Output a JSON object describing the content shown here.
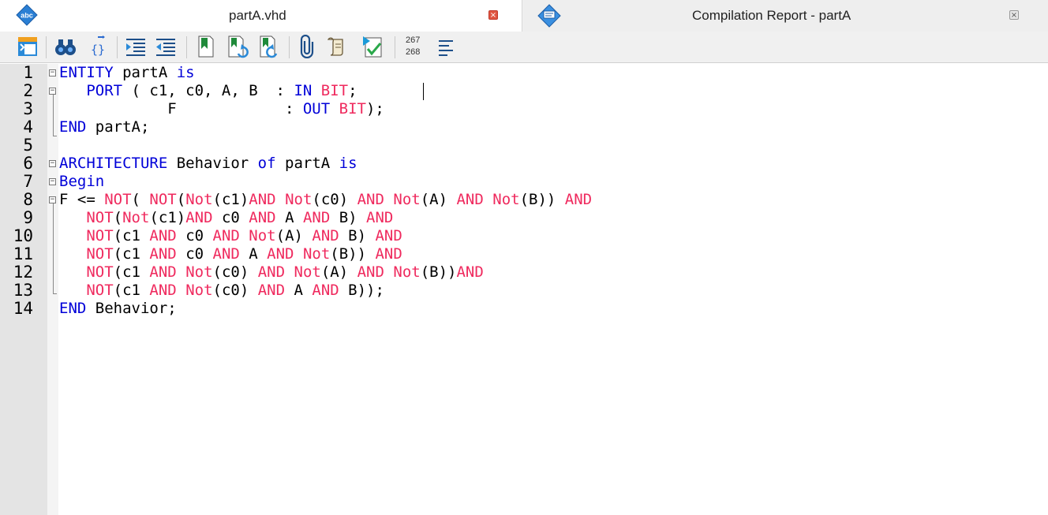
{
  "tabs": [
    {
      "label": "partA.vhd",
      "active": true,
      "icon": "abc-vhdl-file-icon",
      "close_label": "×"
    },
    {
      "label": "Compilation Report - partA",
      "active": false,
      "icon": "compilation-report-icon",
      "close_label": "×"
    }
  ],
  "toolbar": {
    "buttons": [
      "insert-template-icon",
      "find-binoculars-icon",
      "find-matching-brace-icon",
      "increase-indent-icon",
      "decrease-indent-icon",
      "toggle-bookmark-icon",
      "next-bookmark-icon",
      "previous-bookmark-icon",
      "attach-paperclip-icon",
      "insert-scroll-icon",
      "start-compilation-check-icon",
      "go-to-line-icon",
      "toggle-word-wrap-icon"
    ],
    "line_counter": {
      "top": "267",
      "bottom": "268"
    }
  },
  "editor": {
    "line_numbers": [
      "1",
      "2",
      "3",
      "4",
      "5",
      "6",
      "7",
      "8",
      "9",
      "10",
      "11",
      "12",
      "13",
      "14"
    ],
    "lines": [
      [
        {
          "t": "ENTITY",
          "c": "kw"
        },
        {
          "t": " partA ",
          "c": "txt"
        },
        {
          "t": "is",
          "c": "kw"
        }
      ],
      [
        {
          "t": "   ",
          "c": "txt"
        },
        {
          "t": "PORT",
          "c": "kw"
        },
        {
          "t": " ( c1, c0, A, B  : ",
          "c": "txt"
        },
        {
          "t": "IN",
          "c": "kw"
        },
        {
          "t": " ",
          "c": "txt"
        },
        {
          "t": "BIT",
          "c": "op"
        },
        {
          "t": ";",
          "c": "txt"
        }
      ],
      [
        {
          "t": "            F            : ",
          "c": "txt"
        },
        {
          "t": "OUT",
          "c": "kw"
        },
        {
          "t": " ",
          "c": "txt"
        },
        {
          "t": "BIT",
          "c": "op"
        },
        {
          "t": ");",
          "c": "txt"
        }
      ],
      [
        {
          "t": "END",
          "c": "kw"
        },
        {
          "t": " partA;",
          "c": "txt"
        }
      ],
      [],
      [
        {
          "t": "ARCHITECTURE",
          "c": "kw"
        },
        {
          "t": " Behavior ",
          "c": "txt"
        },
        {
          "t": "of",
          "c": "kw"
        },
        {
          "t": " partA ",
          "c": "txt"
        },
        {
          "t": "is",
          "c": "kw"
        }
      ],
      [
        {
          "t": "Begin",
          "c": "kw"
        }
      ],
      [
        {
          "t": "F <= ",
          "c": "txt"
        },
        {
          "t": "NOT",
          "c": "op"
        },
        {
          "t": "( ",
          "c": "txt"
        },
        {
          "t": "NOT",
          "c": "op"
        },
        {
          "t": "(",
          "c": "txt"
        },
        {
          "t": "Not",
          "c": "op"
        },
        {
          "t": "(c1)",
          "c": "txt"
        },
        {
          "t": "AND",
          "c": "op"
        },
        {
          "t": " ",
          "c": "txt"
        },
        {
          "t": "Not",
          "c": "op"
        },
        {
          "t": "(c0) ",
          "c": "txt"
        },
        {
          "t": "AND",
          "c": "op"
        },
        {
          "t": " ",
          "c": "txt"
        },
        {
          "t": "Not",
          "c": "op"
        },
        {
          "t": "(A) ",
          "c": "txt"
        },
        {
          "t": "AND",
          "c": "op"
        },
        {
          "t": " ",
          "c": "txt"
        },
        {
          "t": "Not",
          "c": "op"
        },
        {
          "t": "(B)) ",
          "c": "txt"
        },
        {
          "t": "AND",
          "c": "op"
        }
      ],
      [
        {
          "t": "   ",
          "c": "txt"
        },
        {
          "t": "NOT",
          "c": "op"
        },
        {
          "t": "(",
          "c": "txt"
        },
        {
          "t": "Not",
          "c": "op"
        },
        {
          "t": "(c1)",
          "c": "txt"
        },
        {
          "t": "AND",
          "c": "op"
        },
        {
          "t": " c0 ",
          "c": "txt"
        },
        {
          "t": "AND",
          "c": "op"
        },
        {
          "t": " A ",
          "c": "txt"
        },
        {
          "t": "AND",
          "c": "op"
        },
        {
          "t": " B) ",
          "c": "txt"
        },
        {
          "t": "AND",
          "c": "op"
        }
      ],
      [
        {
          "t": "   ",
          "c": "txt"
        },
        {
          "t": "NOT",
          "c": "op"
        },
        {
          "t": "(c1 ",
          "c": "txt"
        },
        {
          "t": "AND",
          "c": "op"
        },
        {
          "t": " c0 ",
          "c": "txt"
        },
        {
          "t": "AND",
          "c": "op"
        },
        {
          "t": " ",
          "c": "txt"
        },
        {
          "t": "Not",
          "c": "op"
        },
        {
          "t": "(A) ",
          "c": "txt"
        },
        {
          "t": "AND",
          "c": "op"
        },
        {
          "t": " B) ",
          "c": "txt"
        },
        {
          "t": "AND",
          "c": "op"
        }
      ],
      [
        {
          "t": "   ",
          "c": "txt"
        },
        {
          "t": "NOT",
          "c": "op"
        },
        {
          "t": "(c1 ",
          "c": "txt"
        },
        {
          "t": "AND",
          "c": "op"
        },
        {
          "t": " c0 ",
          "c": "txt"
        },
        {
          "t": "AND",
          "c": "op"
        },
        {
          "t": " A ",
          "c": "txt"
        },
        {
          "t": "AND",
          "c": "op"
        },
        {
          "t": " ",
          "c": "txt"
        },
        {
          "t": "Not",
          "c": "op"
        },
        {
          "t": "(B)) ",
          "c": "txt"
        },
        {
          "t": "AND",
          "c": "op"
        }
      ],
      [
        {
          "t": "   ",
          "c": "txt"
        },
        {
          "t": "NOT",
          "c": "op"
        },
        {
          "t": "(c1 ",
          "c": "txt"
        },
        {
          "t": "AND",
          "c": "op"
        },
        {
          "t": " ",
          "c": "txt"
        },
        {
          "t": "Not",
          "c": "op"
        },
        {
          "t": "(c0) ",
          "c": "txt"
        },
        {
          "t": "AND",
          "c": "op"
        },
        {
          "t": " ",
          "c": "txt"
        },
        {
          "t": "Not",
          "c": "op"
        },
        {
          "t": "(A) ",
          "c": "txt"
        },
        {
          "t": "AND",
          "c": "op"
        },
        {
          "t": " ",
          "c": "txt"
        },
        {
          "t": "Not",
          "c": "op"
        },
        {
          "t": "(B))",
          "c": "txt"
        },
        {
          "t": "AND",
          "c": "op"
        }
      ],
      [
        {
          "t": "   ",
          "c": "txt"
        },
        {
          "t": "NOT",
          "c": "op"
        },
        {
          "t": "(c1 ",
          "c": "txt"
        },
        {
          "t": "AND",
          "c": "op"
        },
        {
          "t": " ",
          "c": "txt"
        },
        {
          "t": "Not",
          "c": "op"
        },
        {
          "t": "(c0) ",
          "c": "txt"
        },
        {
          "t": "AND",
          "c": "op"
        },
        {
          "t": " A ",
          "c": "txt"
        },
        {
          "t": "AND",
          "c": "op"
        },
        {
          "t": " B));",
          "c": "txt"
        }
      ],
      [
        {
          "t": "END",
          "c": "kw"
        },
        {
          "t": " Behavior;",
          "c": "txt"
        }
      ]
    ]
  },
  "colors": {
    "keyword": "#0000d8",
    "operator": "#ef2a5e",
    "text": "#000000",
    "gutter": "#e4e4e4"
  }
}
